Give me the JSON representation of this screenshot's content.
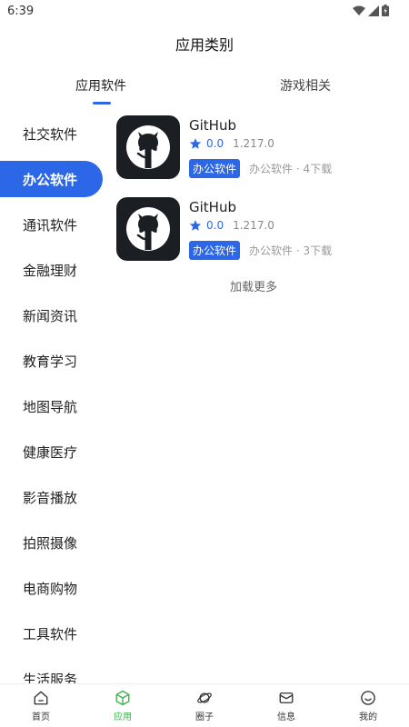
{
  "status_bar": {
    "time": "6:39"
  },
  "page_title": "应用类别",
  "top_tabs": [
    {
      "label": "应用软件",
      "active": true
    },
    {
      "label": "游戏相关",
      "active": false
    }
  ],
  "sidebar": {
    "active_index": 1,
    "items": [
      {
        "label": "社交软件"
      },
      {
        "label": "办公软件"
      },
      {
        "label": "通讯软件"
      },
      {
        "label": "金融理财"
      },
      {
        "label": "新闻资讯"
      },
      {
        "label": "教育学习"
      },
      {
        "label": "地图导航"
      },
      {
        "label": "健康医疗"
      },
      {
        "label": "影音播放"
      },
      {
        "label": "拍照摄像"
      },
      {
        "label": "电商购物"
      },
      {
        "label": "工具软件"
      },
      {
        "label": "生活服务"
      }
    ]
  },
  "apps": [
    {
      "name": "GitHub",
      "rating": "0.0",
      "version": "1.217.0",
      "tag": "办公软件",
      "meta": "办公软件 · 4下载",
      "icon": "github-icon"
    },
    {
      "name": "GitHub",
      "rating": "0.0",
      "version": "1.217.0",
      "tag": "办公软件",
      "meta": "办公软件 · 3下载",
      "icon": "github-icon"
    }
  ],
  "load_more": "加载更多",
  "bottom_nav": [
    {
      "label": "首页",
      "icon": "home-icon"
    },
    {
      "label": "应用",
      "icon": "cube-icon",
      "active": true
    },
    {
      "label": "圈子",
      "icon": "planet-icon"
    },
    {
      "label": "信息",
      "icon": "mail-icon"
    },
    {
      "label": "我的",
      "icon": "smile-icon"
    }
  ],
  "colors": {
    "accent": "#2b67e6",
    "nav_active": "#3bb34a",
    "icon_bg": "#1b1f23"
  }
}
